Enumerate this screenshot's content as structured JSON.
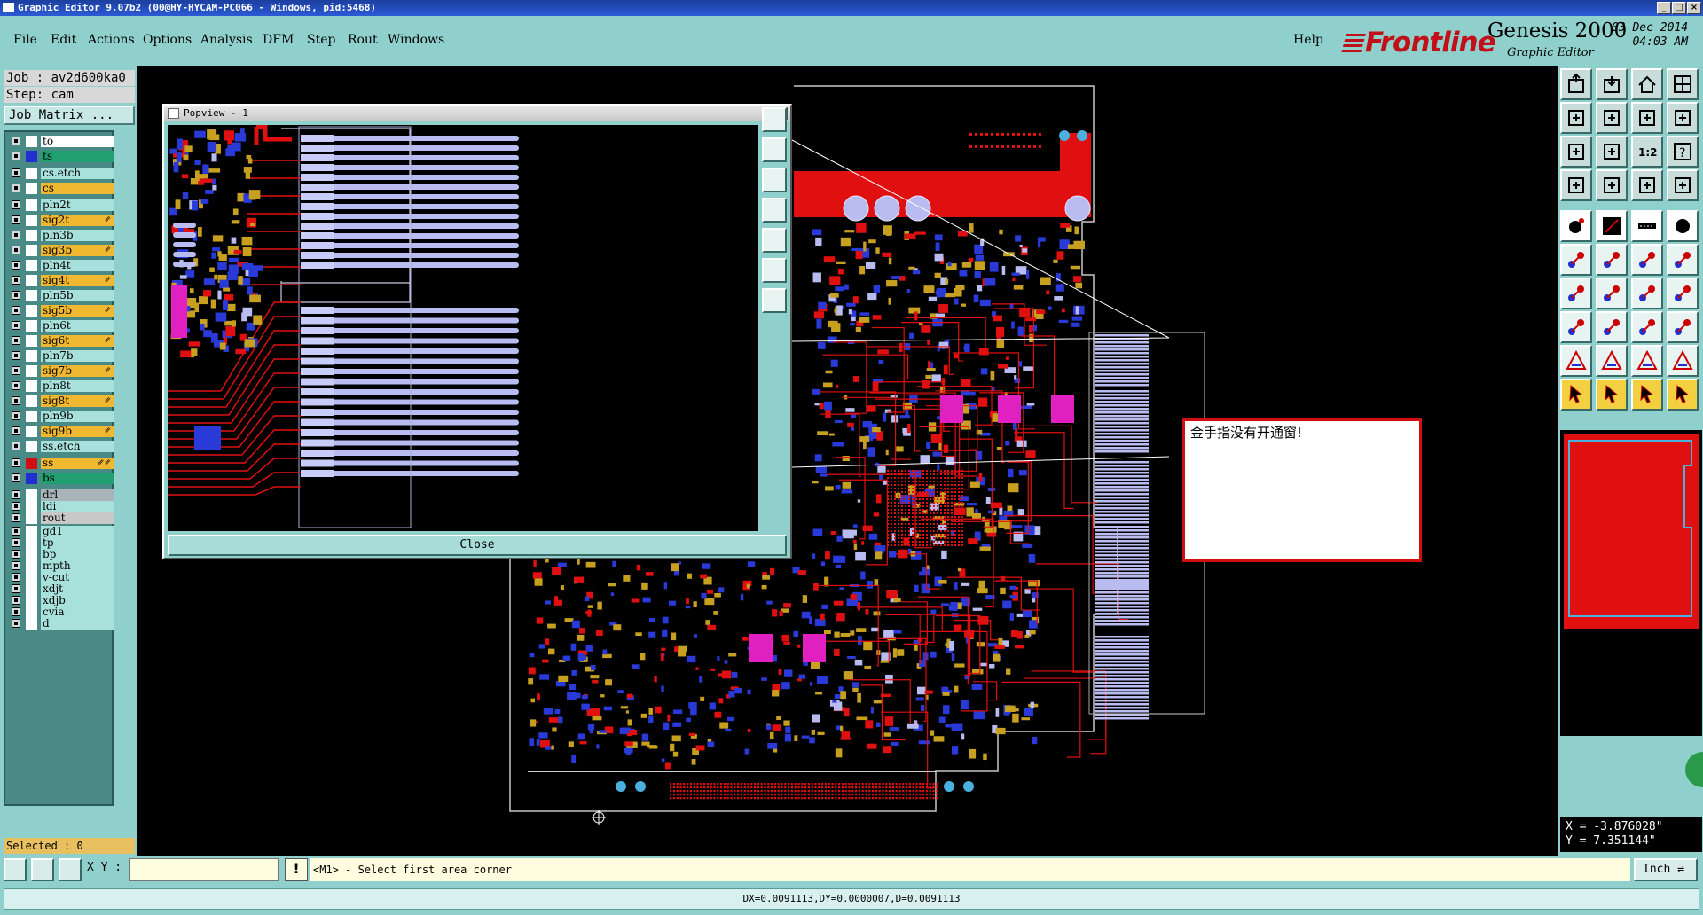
{
  "window": {
    "title": "Graphic Editor 9.07b2 (00@HY-HYCAM-PC066 - Windows, pid:5468)",
    "min_label": "_",
    "max_label": "□",
    "close_label": "×"
  },
  "menu": {
    "items": [
      {
        "label": "File"
      },
      {
        "label": "Edit"
      },
      {
        "label": "Actions"
      },
      {
        "label": "Options"
      },
      {
        "label": "Analysis"
      },
      {
        "label": "DFM"
      },
      {
        "label": "Step"
      },
      {
        "label": "Rout"
      },
      {
        "label": "Windows"
      }
    ],
    "help": "Help"
  },
  "brand": {
    "logo": "Frontline",
    "product": "Genesis 2000",
    "subtitle": "Graphic Editor",
    "date": "03 Dec 2014",
    "time": "04:03 AM"
  },
  "job": {
    "job_line": "Job : av2d600ka0",
    "step_line": "Step: cam",
    "matrix_button": "Job Matrix ..."
  },
  "layers": [
    {
      "name": "to",
      "bg": "#ffffff",
      "swatch": "#ffffff",
      "flag": ""
    },
    {
      "name": "ts",
      "bg": "#20a070",
      "swatch": "#2030d0",
      "flag": ""
    },
    {
      "name": "cs.etch",
      "bg": "#a8e0dc",
      "swatch": "#ffffff",
      "flag": ""
    },
    {
      "name": "cs",
      "bg": "#f0b830",
      "swatch": "#ffffff",
      "flag": ""
    },
    {
      "name": "pln2t",
      "bg": "#a8e0dc",
      "swatch": "#ffffff",
      "flag": ""
    },
    {
      "name": "sig2t",
      "bg": "#f0b830",
      "swatch": "#ffffff",
      "flag": "⇙"
    },
    {
      "name": "pln3b",
      "bg": "#a8e0dc",
      "swatch": "#ffffff",
      "flag": ""
    },
    {
      "name": "sig3b",
      "bg": "#f0b830",
      "swatch": "#ffffff",
      "flag": "⇙"
    },
    {
      "name": "pln4t",
      "bg": "#a8e0dc",
      "swatch": "#ffffff",
      "flag": ""
    },
    {
      "name": "sig4t",
      "bg": "#f0b830",
      "swatch": "#ffffff",
      "flag": "⇙"
    },
    {
      "name": "pln5b",
      "bg": "#a8e0dc",
      "swatch": "#ffffff",
      "flag": ""
    },
    {
      "name": "sig5b",
      "bg": "#f0b830",
      "swatch": "#ffffff",
      "flag": "⇙"
    },
    {
      "name": "pln6t",
      "bg": "#a8e0dc",
      "swatch": "#ffffff",
      "flag": ""
    },
    {
      "name": "sig6t",
      "bg": "#f0b830",
      "swatch": "#ffffff",
      "flag": "⇙"
    },
    {
      "name": "pln7b",
      "bg": "#a8e0dc",
      "swatch": "#ffffff",
      "flag": ""
    },
    {
      "name": "sig7b",
      "bg": "#f0b830",
      "swatch": "#ffffff",
      "flag": "⇙"
    },
    {
      "name": "pln8t",
      "bg": "#a8e0dc",
      "swatch": "#ffffff",
      "flag": ""
    },
    {
      "name": "sig8t",
      "bg": "#f0b830",
      "swatch": "#ffffff",
      "flag": "⇙"
    },
    {
      "name": "pln9b",
      "bg": "#a8e0dc",
      "swatch": "#ffffff",
      "flag": ""
    },
    {
      "name": "sig9b",
      "bg": "#f0b830",
      "swatch": "#ffffff",
      "flag": "⇙"
    },
    {
      "name": "ss.etch",
      "bg": "#a8e0dc",
      "swatch": "#ffffff",
      "flag": ""
    },
    {
      "name": "ss",
      "bg": "#f0b830",
      "swatch": "#d01010",
      "flag": "⇙⇙"
    },
    {
      "name": "bs",
      "bg": "#20a070",
      "swatch": "#2030d0",
      "flag": ""
    },
    {
      "name": "drl",
      "bg": "#a8b4b8",
      "swatch": "#ffffff",
      "flag": ""
    },
    {
      "name": "ldi",
      "bg": "#a8e0dc",
      "swatch": "#ffffff",
      "flag": ""
    },
    {
      "name": "rout",
      "bg": "#c8c8c8",
      "swatch": "#ffffff",
      "flag": ""
    },
    {
      "name": "gd1",
      "bg": "#a8e0dc",
      "swatch": "#ffffff",
      "flag": ""
    },
    {
      "name": "tp",
      "bg": "#a8e0dc",
      "swatch": "#ffffff",
      "flag": ""
    },
    {
      "name": "bp",
      "bg": "#a8e0dc",
      "swatch": "#ffffff",
      "flag": ""
    },
    {
      "name": "mpth",
      "bg": "#a8e0dc",
      "swatch": "#ffffff",
      "flag": ""
    },
    {
      "name": "v-cut",
      "bg": "#a8e0dc",
      "swatch": "#ffffff",
      "flag": ""
    },
    {
      "name": "xdjt",
      "bg": "#a8e0dc",
      "swatch": "#ffffff",
      "flag": ""
    },
    {
      "name": "xdjb",
      "bg": "#a8e0dc",
      "swatch": "#ffffff",
      "flag": ""
    },
    {
      "name": "cvia",
      "bg": "#a8e0dc",
      "swatch": "#ffffff",
      "flag": ""
    },
    {
      "name": "d",
      "bg": "#a8e0dc",
      "swatch": "#ffffff",
      "flag": ""
    }
  ],
  "selected_label": "Selected : 0",
  "popview": {
    "title": "Popview - 1",
    "close_x": "×",
    "close_button": "Close"
  },
  "note": {
    "text": "金手指没有开通窗!"
  },
  "coords": {
    "x_line": "X = -3.876028\"",
    "y_line": "Y = 7.351144\""
  },
  "statusbar": {
    "xy_label": "X Y :",
    "xy_value": "",
    "warn_label": "!",
    "message": "<M1> - Select first area corner",
    "units": "Inch"
  },
  "measure": {
    "text": "DX=0.0091113,DY=0.0000007,D=0.0091113"
  },
  "colors": {
    "panel": "#8fd0cc",
    "copper": "#d01010",
    "pad_blue": "#2030d0",
    "pad_gold": "#c8a020",
    "finger": "#b8bcf0"
  },
  "toolbar_icons": [
    "open-icon",
    "save-icon",
    "home-icon",
    "window-icon",
    "undo-icon",
    "redo-icon",
    "zoom-back-icon",
    "snap-icon",
    "fit-icon",
    "zoom-fit-icon",
    "scale-icon",
    "help-icon",
    "measure-icon",
    "grid-icon",
    "layers-up-icon",
    "layers-down-icon",
    "pad-icon",
    "feature-icon",
    "line-icon",
    "dot-icon",
    "connect-icon",
    "delete-icon",
    "route-icon",
    "split-icon",
    "draw-line-icon",
    "draw-line2-icon",
    "rotate-icon",
    "mirror-icon",
    "node-icon",
    "minus-icon",
    "resize-icon",
    "spread-icon",
    "tri-icon",
    "tri2-icon",
    "tri3-icon",
    "tri4-icon",
    "pointer-icon",
    "pointer2-icon",
    "pointer3-icon",
    "pointer4-icon"
  ]
}
